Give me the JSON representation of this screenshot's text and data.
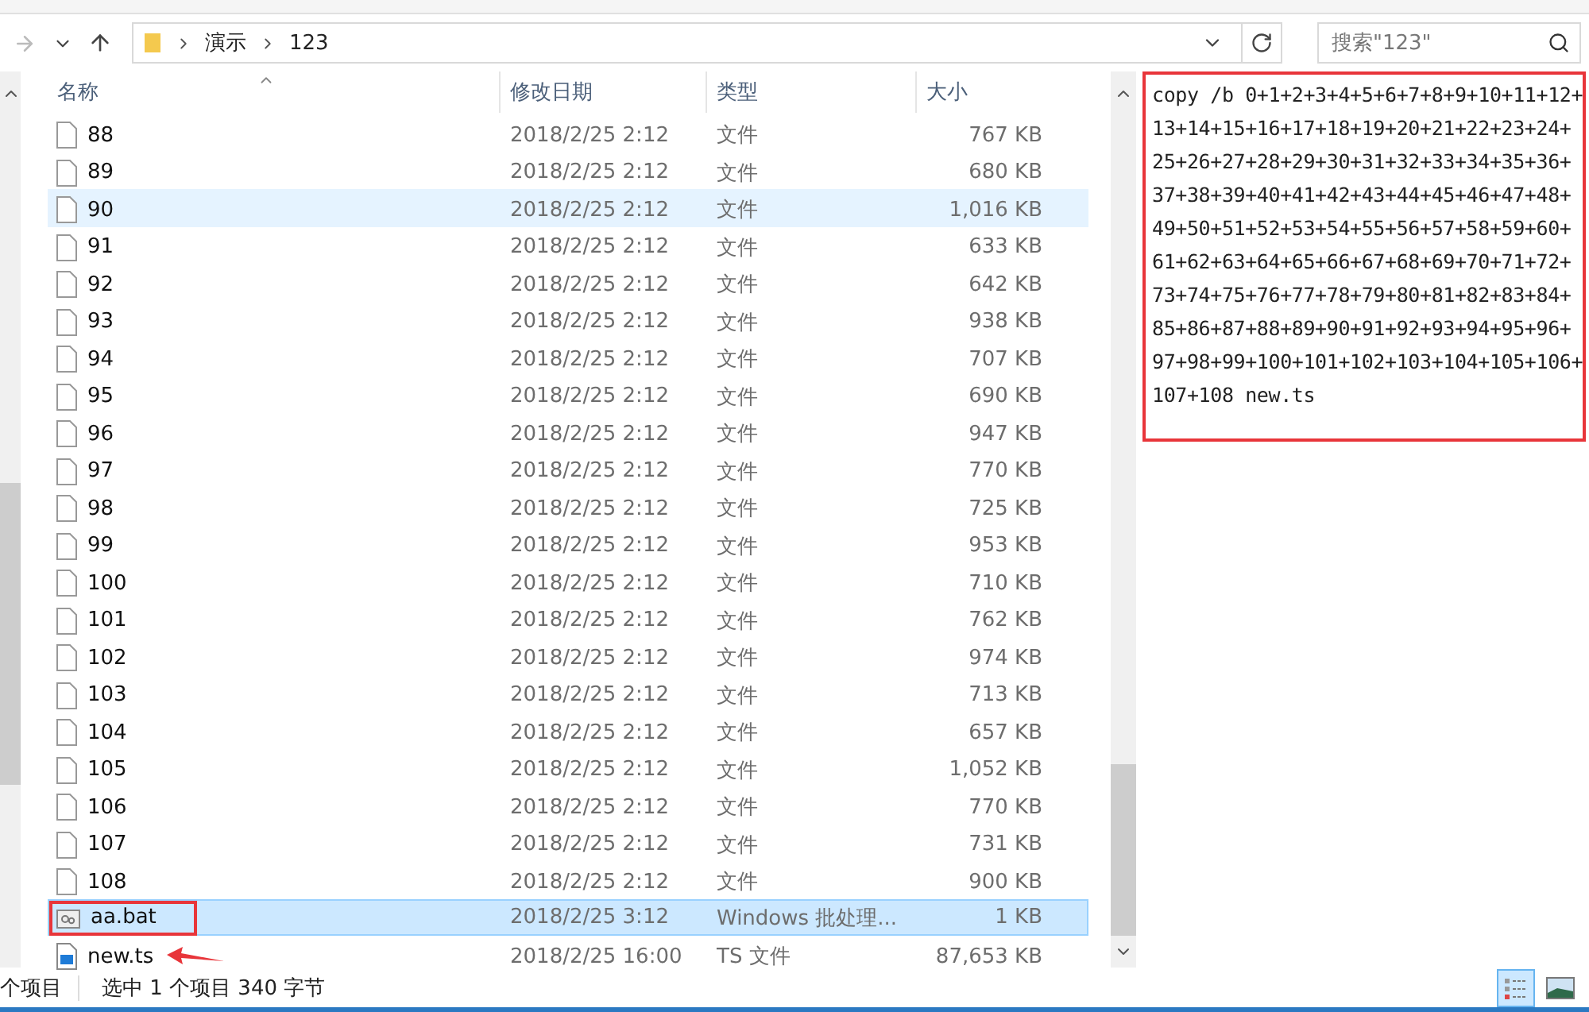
{
  "address_bar": {
    "segments": [
      "演示",
      "123"
    ]
  },
  "search": {
    "placeholder": "搜索\"123\""
  },
  "table": {
    "columns": [
      "名称",
      "修改日期",
      "类型",
      "大小"
    ],
    "rows": [
      {
        "name": "88",
        "date": "2018/2/25 2:12",
        "type": "文件",
        "size": "767 KB",
        "kind": "file",
        "selected": false,
        "hovered": false,
        "marked": false
      },
      {
        "name": "89",
        "date": "2018/2/25 2:12",
        "type": "文件",
        "size": "680 KB",
        "kind": "file",
        "selected": false,
        "hovered": false,
        "marked": false
      },
      {
        "name": "90",
        "date": "2018/2/25 2:12",
        "type": "文件",
        "size": "1,016 KB",
        "kind": "file",
        "selected": false,
        "hovered": true,
        "marked": false
      },
      {
        "name": "91",
        "date": "2018/2/25 2:12",
        "type": "文件",
        "size": "633 KB",
        "kind": "file",
        "selected": false,
        "hovered": false,
        "marked": false
      },
      {
        "name": "92",
        "date": "2018/2/25 2:12",
        "type": "文件",
        "size": "642 KB",
        "kind": "file",
        "selected": false,
        "hovered": false,
        "marked": false
      },
      {
        "name": "93",
        "date": "2018/2/25 2:12",
        "type": "文件",
        "size": "938 KB",
        "kind": "file",
        "selected": false,
        "hovered": false,
        "marked": false
      },
      {
        "name": "94",
        "date": "2018/2/25 2:12",
        "type": "文件",
        "size": "707 KB",
        "kind": "file",
        "selected": false,
        "hovered": false,
        "marked": false
      },
      {
        "name": "95",
        "date": "2018/2/25 2:12",
        "type": "文件",
        "size": "690 KB",
        "kind": "file",
        "selected": false,
        "hovered": false,
        "marked": false
      },
      {
        "name": "96",
        "date": "2018/2/25 2:12",
        "type": "文件",
        "size": "947 KB",
        "kind": "file",
        "selected": false,
        "hovered": false,
        "marked": false
      },
      {
        "name": "97",
        "date": "2018/2/25 2:12",
        "type": "文件",
        "size": "770 KB",
        "kind": "file",
        "selected": false,
        "hovered": false,
        "marked": false
      },
      {
        "name": "98",
        "date": "2018/2/25 2:12",
        "type": "文件",
        "size": "725 KB",
        "kind": "file",
        "selected": false,
        "hovered": false,
        "marked": false
      },
      {
        "name": "99",
        "date": "2018/2/25 2:12",
        "type": "文件",
        "size": "953 KB",
        "kind": "file",
        "selected": false,
        "hovered": false,
        "marked": false
      },
      {
        "name": "100",
        "date": "2018/2/25 2:12",
        "type": "文件",
        "size": "710 KB",
        "kind": "file",
        "selected": false,
        "hovered": false,
        "marked": false
      },
      {
        "name": "101",
        "date": "2018/2/25 2:12",
        "type": "文件",
        "size": "762 KB",
        "kind": "file",
        "selected": false,
        "hovered": false,
        "marked": false
      },
      {
        "name": "102",
        "date": "2018/2/25 2:12",
        "type": "文件",
        "size": "974 KB",
        "kind": "file",
        "selected": false,
        "hovered": false,
        "marked": false
      },
      {
        "name": "103",
        "date": "2018/2/25 2:12",
        "type": "文件",
        "size": "713 KB",
        "kind": "file",
        "selected": false,
        "hovered": false,
        "marked": false
      },
      {
        "name": "104",
        "date": "2018/2/25 2:12",
        "type": "文件",
        "size": "657 KB",
        "kind": "file",
        "selected": false,
        "hovered": false,
        "marked": false
      },
      {
        "name": "105",
        "date": "2018/2/25 2:12",
        "type": "文件",
        "size": "1,052 KB",
        "kind": "file",
        "selected": false,
        "hovered": false,
        "marked": false
      },
      {
        "name": "106",
        "date": "2018/2/25 2:12",
        "type": "文件",
        "size": "770 KB",
        "kind": "file",
        "selected": false,
        "hovered": false,
        "marked": false
      },
      {
        "name": "107",
        "date": "2018/2/25 2:12",
        "type": "文件",
        "size": "731 KB",
        "kind": "file",
        "selected": false,
        "hovered": false,
        "marked": false
      },
      {
        "name": "108",
        "date": "2018/2/25 2:12",
        "type": "文件",
        "size": "900 KB",
        "kind": "file",
        "selected": false,
        "hovered": false,
        "marked": false
      },
      {
        "name": "aa.bat",
        "date": "2018/2/25 3:12",
        "type": "Windows 批处理...",
        "size": "1 KB",
        "kind": "batch",
        "selected": true,
        "hovered": false,
        "marked": true
      },
      {
        "name": "new.ts",
        "date": "2018/2/25 16:00",
        "type": "TS 文件",
        "size": "87,653 KB",
        "kind": "video",
        "selected": false,
        "hovered": false,
        "marked": false,
        "arrow": true
      }
    ]
  },
  "preview": {
    "marked": true,
    "lines": [
      "copy /b 0+1+2+3+4+5+6+7+8+9+10+11+12+",
      "13+14+15+16+17+18+19+20+21+22+23+24+",
      "25+26+27+28+29+30+31+32+33+34+35+36+",
      "37+38+39+40+41+42+43+44+45+46+47+48+",
      "49+50+51+52+53+54+55+56+57+58+59+60+",
      "61+62+63+64+65+66+67+68+69+70+71+72+",
      "73+74+75+76+77+78+79+80+81+82+83+84+",
      "85+86+87+88+89+90+91+92+93+94+95+96+",
      "97+98+99+100+101+102+103+104+105+106+",
      "107+108 new.ts"
    ]
  },
  "status_bar": {
    "count": "个项目",
    "selection": "选中 1 个项目  340 字节"
  },
  "view_buttons": [
    {
      "kind": "details",
      "selected": true
    },
    {
      "kind": "large",
      "selected": false
    }
  ]
}
